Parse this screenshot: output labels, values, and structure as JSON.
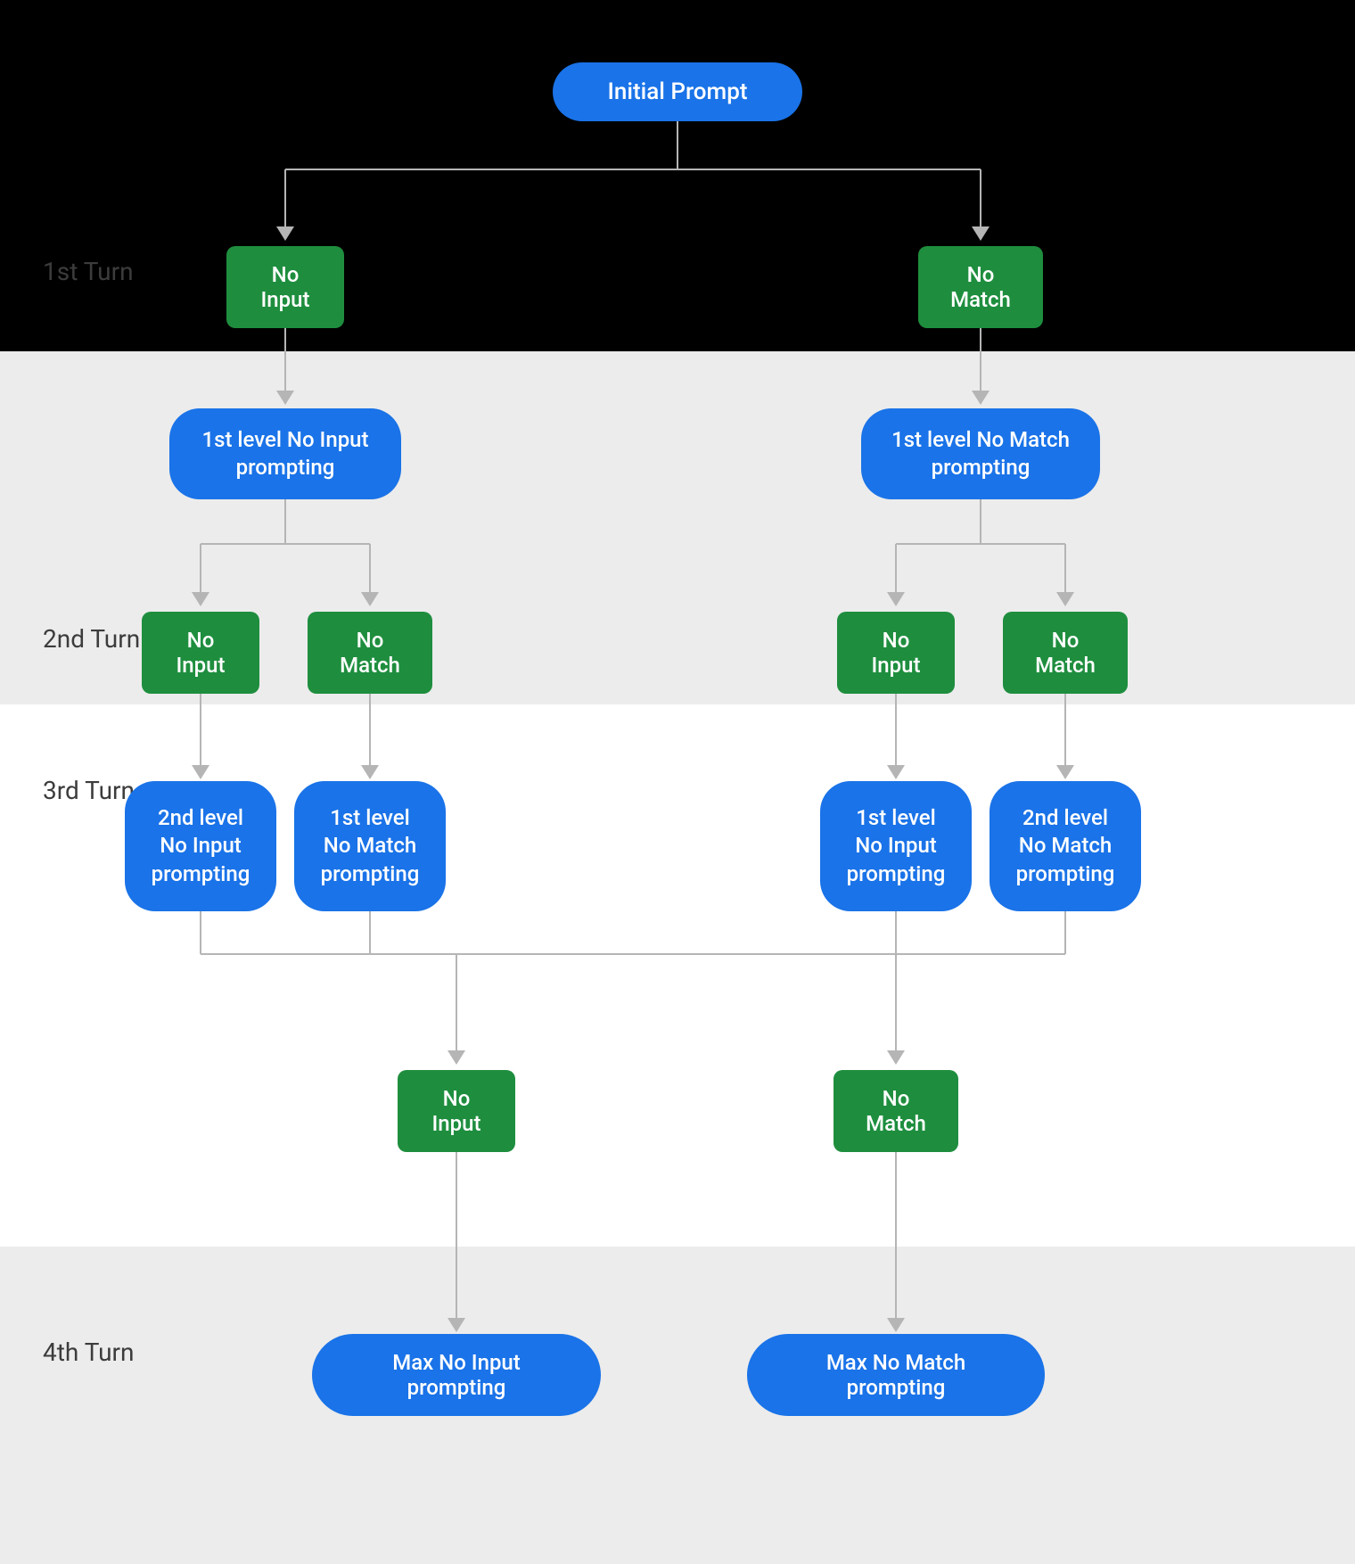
{
  "labels": {
    "turn1": "1st Turn",
    "turn2": "2nd Turn",
    "turn3": "3rd Turn",
    "turn4": "4th Turn"
  },
  "nodes": {
    "initial": "Initial Prompt",
    "no_input": "No Input",
    "no_match": "No Match",
    "l1_no_input": "1st level No Input prompting",
    "l1_no_match": "1st level No Match prompting",
    "l2_no_input": "2nd level No Input prompting",
    "l2_no_match": "2nd level No Match prompting",
    "max_no_input": "Max No Input prompting",
    "max_no_match": "Max No Match prompting"
  },
  "colors": {
    "blue": "#1a73e8",
    "green": "#1e8e3e",
    "black": "#000000",
    "grey": "#ececec"
  }
}
